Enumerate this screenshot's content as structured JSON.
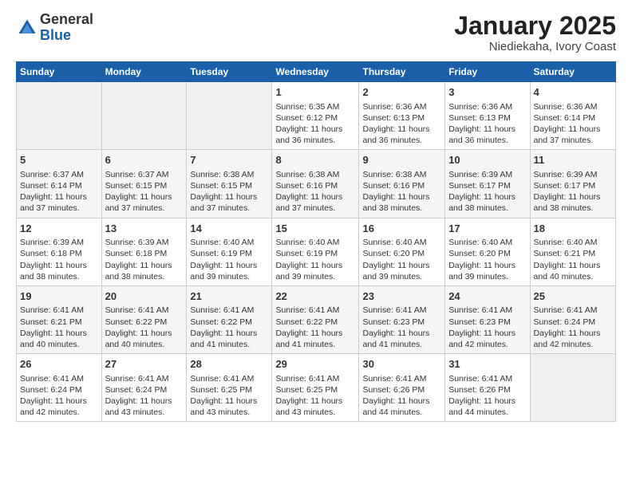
{
  "logo": {
    "general": "General",
    "blue": "Blue"
  },
  "title": "January 2025",
  "subtitle": "Niediekaha, Ivory Coast",
  "days_of_week": [
    "Sunday",
    "Monday",
    "Tuesday",
    "Wednesday",
    "Thursday",
    "Friday",
    "Saturday"
  ],
  "weeks": [
    [
      {
        "day": "",
        "info": ""
      },
      {
        "day": "",
        "info": ""
      },
      {
        "day": "",
        "info": ""
      },
      {
        "day": "1",
        "info": "Sunrise: 6:35 AM\nSunset: 6:12 PM\nDaylight: 11 hours\nand 36 minutes."
      },
      {
        "day": "2",
        "info": "Sunrise: 6:36 AM\nSunset: 6:13 PM\nDaylight: 11 hours\nand 36 minutes."
      },
      {
        "day": "3",
        "info": "Sunrise: 6:36 AM\nSunset: 6:13 PM\nDaylight: 11 hours\nand 36 minutes."
      },
      {
        "day": "4",
        "info": "Sunrise: 6:36 AM\nSunset: 6:14 PM\nDaylight: 11 hours\nand 37 minutes."
      }
    ],
    [
      {
        "day": "5",
        "info": "Sunrise: 6:37 AM\nSunset: 6:14 PM\nDaylight: 11 hours\nand 37 minutes."
      },
      {
        "day": "6",
        "info": "Sunrise: 6:37 AM\nSunset: 6:15 PM\nDaylight: 11 hours\nand 37 minutes."
      },
      {
        "day": "7",
        "info": "Sunrise: 6:38 AM\nSunset: 6:15 PM\nDaylight: 11 hours\nand 37 minutes."
      },
      {
        "day": "8",
        "info": "Sunrise: 6:38 AM\nSunset: 6:16 PM\nDaylight: 11 hours\nand 37 minutes."
      },
      {
        "day": "9",
        "info": "Sunrise: 6:38 AM\nSunset: 6:16 PM\nDaylight: 11 hours\nand 38 minutes."
      },
      {
        "day": "10",
        "info": "Sunrise: 6:39 AM\nSunset: 6:17 PM\nDaylight: 11 hours\nand 38 minutes."
      },
      {
        "day": "11",
        "info": "Sunrise: 6:39 AM\nSunset: 6:17 PM\nDaylight: 11 hours\nand 38 minutes."
      }
    ],
    [
      {
        "day": "12",
        "info": "Sunrise: 6:39 AM\nSunset: 6:18 PM\nDaylight: 11 hours\nand 38 minutes."
      },
      {
        "day": "13",
        "info": "Sunrise: 6:39 AM\nSunset: 6:18 PM\nDaylight: 11 hours\nand 38 minutes."
      },
      {
        "day": "14",
        "info": "Sunrise: 6:40 AM\nSunset: 6:19 PM\nDaylight: 11 hours\nand 39 minutes."
      },
      {
        "day": "15",
        "info": "Sunrise: 6:40 AM\nSunset: 6:19 PM\nDaylight: 11 hours\nand 39 minutes."
      },
      {
        "day": "16",
        "info": "Sunrise: 6:40 AM\nSunset: 6:20 PM\nDaylight: 11 hours\nand 39 minutes."
      },
      {
        "day": "17",
        "info": "Sunrise: 6:40 AM\nSunset: 6:20 PM\nDaylight: 11 hours\nand 39 minutes."
      },
      {
        "day": "18",
        "info": "Sunrise: 6:40 AM\nSunset: 6:21 PM\nDaylight: 11 hours\nand 40 minutes."
      }
    ],
    [
      {
        "day": "19",
        "info": "Sunrise: 6:41 AM\nSunset: 6:21 PM\nDaylight: 11 hours\nand 40 minutes."
      },
      {
        "day": "20",
        "info": "Sunrise: 6:41 AM\nSunset: 6:22 PM\nDaylight: 11 hours\nand 40 minutes."
      },
      {
        "day": "21",
        "info": "Sunrise: 6:41 AM\nSunset: 6:22 PM\nDaylight: 11 hours\nand 41 minutes."
      },
      {
        "day": "22",
        "info": "Sunrise: 6:41 AM\nSunset: 6:22 PM\nDaylight: 11 hours\nand 41 minutes."
      },
      {
        "day": "23",
        "info": "Sunrise: 6:41 AM\nSunset: 6:23 PM\nDaylight: 11 hours\nand 41 minutes."
      },
      {
        "day": "24",
        "info": "Sunrise: 6:41 AM\nSunset: 6:23 PM\nDaylight: 11 hours\nand 42 minutes."
      },
      {
        "day": "25",
        "info": "Sunrise: 6:41 AM\nSunset: 6:24 PM\nDaylight: 11 hours\nand 42 minutes."
      }
    ],
    [
      {
        "day": "26",
        "info": "Sunrise: 6:41 AM\nSunset: 6:24 PM\nDaylight: 11 hours\nand 42 minutes."
      },
      {
        "day": "27",
        "info": "Sunrise: 6:41 AM\nSunset: 6:24 PM\nDaylight: 11 hours\nand 43 minutes."
      },
      {
        "day": "28",
        "info": "Sunrise: 6:41 AM\nSunset: 6:25 PM\nDaylight: 11 hours\nand 43 minutes."
      },
      {
        "day": "29",
        "info": "Sunrise: 6:41 AM\nSunset: 6:25 PM\nDaylight: 11 hours\nand 43 minutes."
      },
      {
        "day": "30",
        "info": "Sunrise: 6:41 AM\nSunset: 6:26 PM\nDaylight: 11 hours\nand 44 minutes."
      },
      {
        "day": "31",
        "info": "Sunrise: 6:41 AM\nSunset: 6:26 PM\nDaylight: 11 hours\nand 44 minutes."
      },
      {
        "day": "",
        "info": ""
      }
    ]
  ]
}
